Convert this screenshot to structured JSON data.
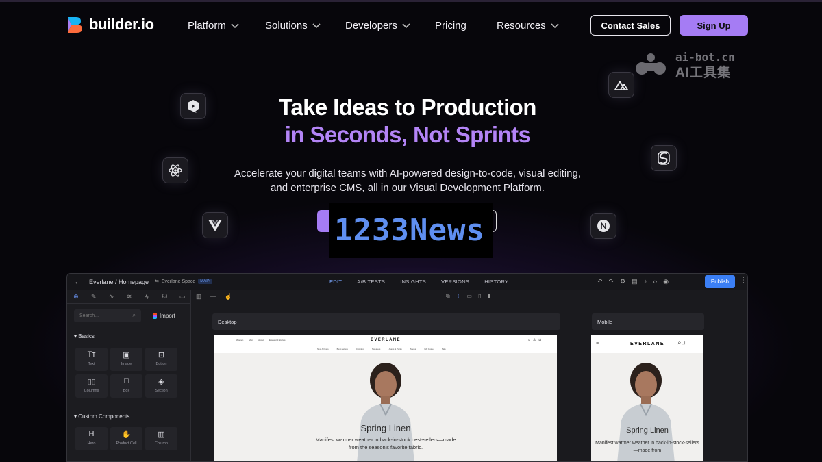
{
  "nav": {
    "logo_text": "builder.io",
    "menu": [
      {
        "label": "Platform",
        "has_dropdown": true
      },
      {
        "label": "Solutions",
        "has_dropdown": true
      },
      {
        "label": "Developers",
        "has_dropdown": true
      },
      {
        "label": "Pricing",
        "has_dropdown": false
      },
      {
        "label": "Resources",
        "has_dropdown": true
      }
    ],
    "contact_label": "Contact Sales",
    "signup_label": "Sign Up"
  },
  "watermark": {
    "line1": "ai-bot.cn",
    "line2": "AI工具集"
  },
  "hero": {
    "title_line1": "Take Ideas to Production",
    "title_line2": "in Seconds, Not Sprints",
    "subtitle": "Accelerate your digital teams with AI-powered design-to-code, visual editing, and enterprise CMS, all in our Visual Development Platform.",
    "accent_color": "#b384f6"
  },
  "framework_icons": [
    "qwik-icon",
    "react-icon",
    "vue-icon",
    "nuxt-icon",
    "svelte-icon",
    "nextjs-icon"
  ],
  "overlay": {
    "text": "1233News"
  },
  "app": {
    "breadcrumb": "Everlane / Homepage",
    "space_label": "Everlane Space",
    "space_tag": "MAIN",
    "tabs": [
      "EDIT",
      "A/B TESTS",
      "INSIGHTS",
      "VERSIONS",
      "HISTORY"
    ],
    "active_tab": "EDIT",
    "publish_label": "Publish",
    "search_placeholder": "Search...",
    "import_label": "Import",
    "basics_label": "Basics",
    "basics_blocks": [
      {
        "icon": "Tт",
        "label": "Text"
      },
      {
        "icon": "▣",
        "label": "Image"
      },
      {
        "icon": "⊡",
        "label": "Button"
      },
      {
        "icon": "▯▯",
        "label": "Columns"
      },
      {
        "icon": "□",
        "label": "Box"
      },
      {
        "icon": "◈",
        "label": "Section"
      }
    ],
    "custom_label": "Custom Components",
    "custom_blocks": [
      {
        "icon": "H",
        "label": "Hero"
      },
      {
        "icon": "✋",
        "label": "Product Cell"
      },
      {
        "icon": "▥",
        "label": "Column"
      }
    ],
    "desktop_label": "Desktop",
    "mobile_label": "Mobile",
    "site": {
      "brand": "EVERLANE",
      "headline": "Spring Linen",
      "desktop_sub": "Manifest warmer weather in back-in-stock best-sellers—made from the season's favorite fabric.",
      "mobile_sub": "Manifest warmer weather in back-in-stock-sellers—made from",
      "nav_links": [
        "Women",
        "Men",
        "About",
        "Everworld Stories"
      ],
      "categories": [
        "New Arrivals",
        "Best-Sellers",
        "Clothing",
        "Sweaters",
        "Jeans & Pants",
        "Shoes",
        "Gift Guide",
        "Sale"
      ]
    }
  },
  "colors": {
    "brand_purple": "#a57cf4",
    "publish_blue": "#3b7ff5"
  }
}
